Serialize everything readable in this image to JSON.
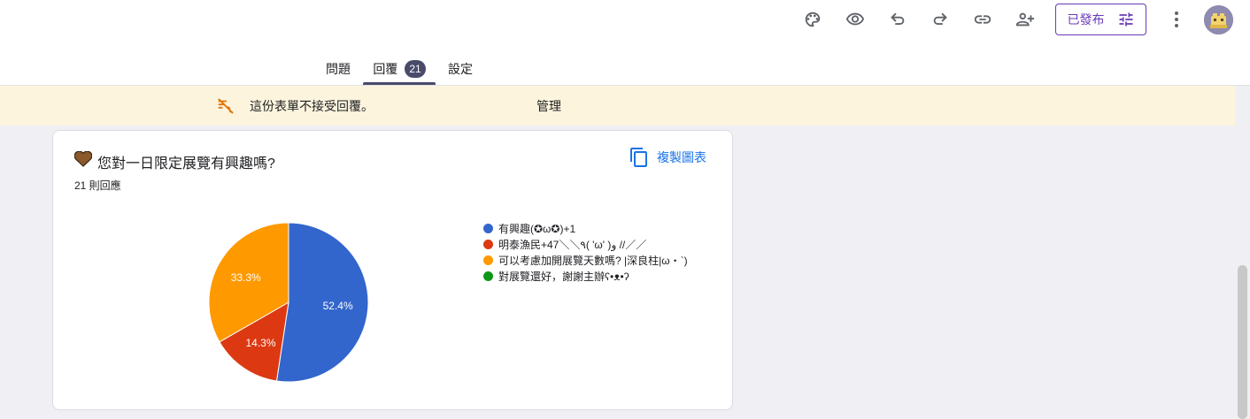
{
  "toolbar": {
    "icons": [
      "palette-icon",
      "eye-icon",
      "undo-icon",
      "redo-icon",
      "link-icon",
      "add-collaborator-icon"
    ],
    "publish_label": "已發布",
    "accent": "#673ab7"
  },
  "tabs": [
    {
      "label": "問題"
    },
    {
      "label": "回覆",
      "badge": "21",
      "active": true
    },
    {
      "label": "設定"
    }
  ],
  "banner": {
    "text": "這份表單不接受回覆。",
    "manage_label": "管理",
    "background": "#fcf4dd"
  },
  "question": {
    "title": "您對一日限定展覽有興趣嗎?",
    "response_count": "21 則回應",
    "copy_chart_label": "複製圖表"
  },
  "chart_data": {
    "type": "pie",
    "start_angle": 90,
    "direction": "clockwise",
    "slices": [
      {
        "label": "有興趣(✪ω✪)+1",
        "value": 52.4,
        "display": "52.4%",
        "color": "#3366cc"
      },
      {
        "label": "明泰漁民+47＼＼٩( 'ω' )و //／／",
        "value": 14.3,
        "display": "14.3%",
        "color": "#dc3912"
      },
      {
        "label": "可以考慮加開展覽天數嗎? |深良柱|ω・`)",
        "value": 33.3,
        "display": "33.3%",
        "color": "#ff9900"
      },
      {
        "label": "對展覽還好，謝謝主辦ʕ•ᴥ•ʔ",
        "value": 0,
        "display": "",
        "color": "#109618"
      }
    ],
    "legend": "right"
  }
}
